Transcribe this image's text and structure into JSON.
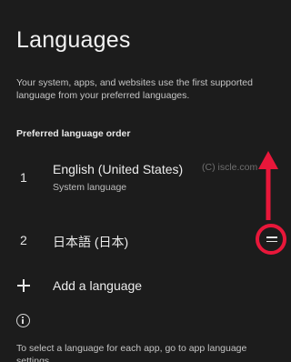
{
  "header": {
    "title": "Languages",
    "description": "Your system, apps, and websites use the first supported language from your preferred languages."
  },
  "section": {
    "preferred_label": "Preferred language order"
  },
  "languages": [
    {
      "number": "1",
      "name": "English (United States)",
      "subtitle": "System language"
    },
    {
      "number": "2",
      "name": "日本語 (日本)",
      "subtitle": ""
    }
  ],
  "watermark": "(C) iscle.com",
  "add_language": {
    "label": "Add a language"
  },
  "footer": {
    "text": "To select a language for each app, go to app language settings."
  },
  "icons": {
    "drag": "drag-handle-icon",
    "plus": "plus-icon",
    "info": "info-icon",
    "arrow": "arrow-up-annotation"
  },
  "colors": {
    "background": "#1c1c1c",
    "annotation": "#e8173a"
  }
}
